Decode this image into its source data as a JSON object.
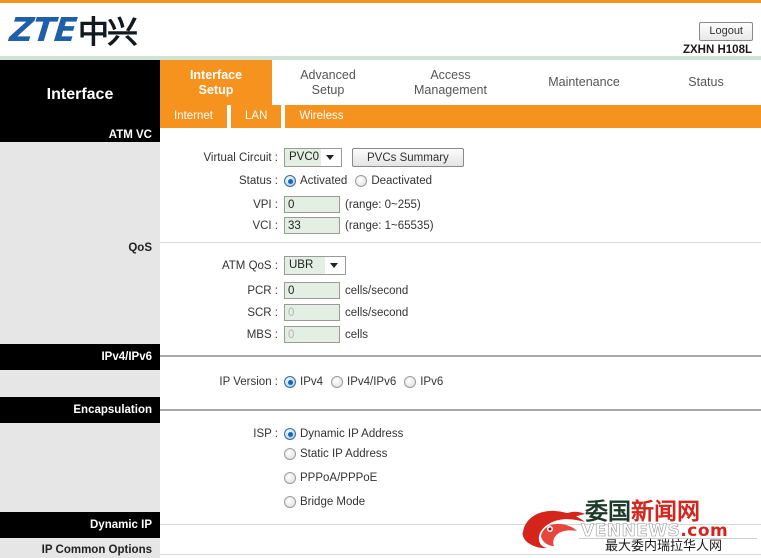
{
  "header": {
    "logo_latin": "ZTE",
    "logo_cn": "中兴",
    "logout_label": "Logout",
    "model": "ZXHN H108L"
  },
  "brand": {
    "label": "Interface"
  },
  "nav": {
    "tabs": [
      {
        "label": "Interface\nSetup",
        "line1": "Interface",
        "line2": "Setup",
        "active": true
      },
      {
        "label": "Advanced Setup",
        "line1": "Advanced",
        "line2": "Setup",
        "active": false
      },
      {
        "label": "Access Management",
        "line1": "Access",
        "line2": "Management",
        "active": false
      },
      {
        "label": "Maintenance",
        "line1": "Maintenance",
        "line2": "",
        "active": false
      },
      {
        "label": "Status",
        "line1": "Status",
        "line2": "",
        "active": false
      }
    ],
    "subtabs": [
      {
        "label": "Internet",
        "active": true
      },
      {
        "label": "LAN",
        "active": false
      },
      {
        "label": "Wireless",
        "active": false
      }
    ]
  },
  "sidebar": {
    "items": [
      {
        "label": "ATM VC",
        "style": "black"
      },
      {
        "label": "QoS",
        "style": "plain"
      },
      {
        "label": "IPv4/IPv6",
        "style": "black"
      },
      {
        "label": "Encapsulation",
        "style": "black"
      },
      {
        "label": "Dynamic IP",
        "style": "black"
      },
      {
        "label": "IP Common Options",
        "style": "plain"
      }
    ]
  },
  "form": {
    "virtual_circuit": {
      "label": "Virtual Circuit :",
      "value": "PVC0",
      "button_label": "PVCs Summary"
    },
    "status": {
      "label": "Status :",
      "options": [
        {
          "label": "Activated",
          "checked": true
        },
        {
          "label": "Deactivated",
          "checked": false
        }
      ]
    },
    "vpi": {
      "label": "VPI :",
      "value": "0",
      "hint": "(range: 0~255)"
    },
    "vci": {
      "label": "VCI :",
      "value": "33",
      "hint": "(range: 1~65535)"
    },
    "atm_qos": {
      "label": "ATM QoS :",
      "value": "UBR"
    },
    "pcr": {
      "label": "PCR :",
      "value": "0",
      "hint": "cells/second",
      "disabled": false
    },
    "scr": {
      "label": "SCR :",
      "value": "0",
      "hint": "cells/second",
      "disabled": true
    },
    "mbs": {
      "label": "MBS :",
      "value": "0",
      "hint": "cells",
      "disabled": true
    },
    "ip_version": {
      "label": "IP Version :",
      "options": [
        {
          "label": "IPv4",
          "checked": true
        },
        {
          "label": "IPv4/IPv6",
          "checked": false
        },
        {
          "label": "IPv6",
          "checked": false
        }
      ]
    },
    "isp": {
      "label": "ISP :",
      "options": [
        {
          "label": "Dynamic IP Address",
          "checked": true
        },
        {
          "label": "Static IP Address",
          "checked": false
        },
        {
          "label": "PPPoA/PPPoE",
          "checked": false
        },
        {
          "label": "Bridge Mode",
          "checked": false
        }
      ]
    }
  },
  "watermark": {
    "cn_dark": "委国",
    "cn_red": "新闻网",
    "latin_white": "VENNEWS",
    "latin_red": ".com",
    "tagline": "最大委内瑞拉华人网"
  },
  "colors": {
    "accent_orange": "#f6921e",
    "brand_blue": "#1e5faa",
    "mint": "#cfe3d4",
    "sidebar_grey": "#e6e6e6",
    "field_green": "#e3efe2",
    "watermark_red": "#d5241c"
  }
}
